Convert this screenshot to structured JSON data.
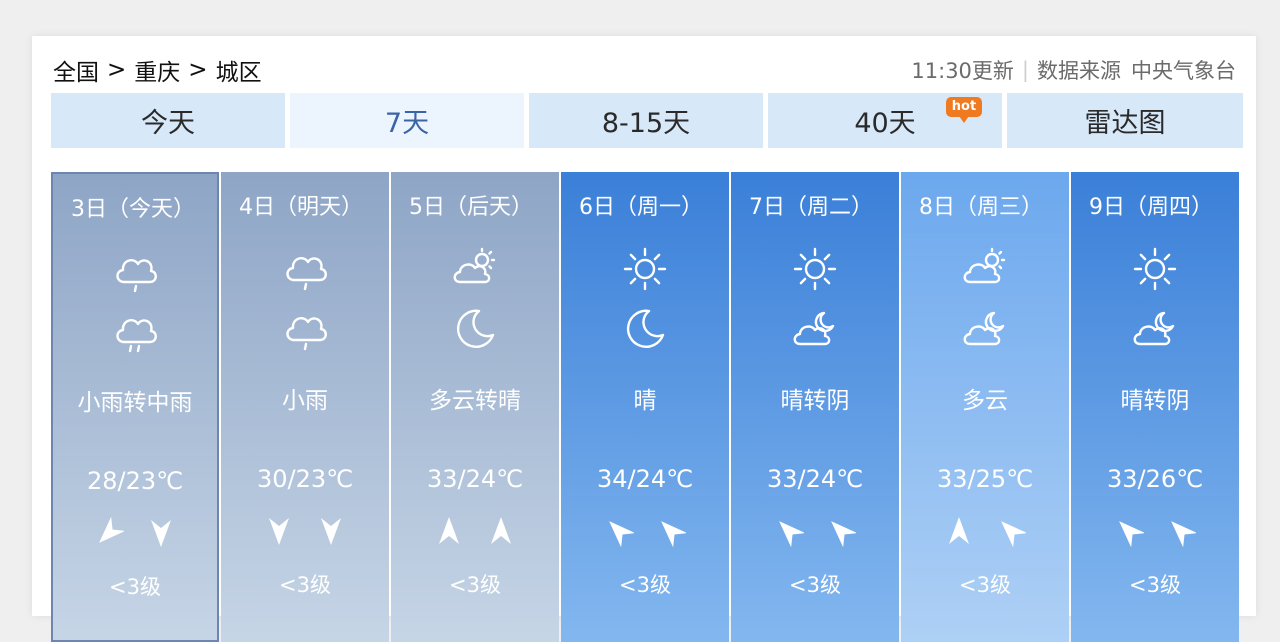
{
  "breadcrumb": {
    "country": "全国",
    "sep": ">",
    "province": "重庆",
    "district": "城区"
  },
  "meta": {
    "update": "11:30更新",
    "divider": "|",
    "source_label": "数据来源",
    "source": "中央气象台"
  },
  "tabs": [
    {
      "label": "今天",
      "active": false
    },
    {
      "label": "7天",
      "active": true
    },
    {
      "label": "8-15天",
      "active": false
    },
    {
      "label": "40天",
      "active": false,
      "badge": "hot"
    },
    {
      "label": "雷达图",
      "active": false
    }
  ],
  "days": [
    {
      "date": "3日（今天）",
      "day_icon": "rain-light-icon",
      "night_icon": "rain-medium-icon",
      "desc": "小雨转中雨",
      "temp": "28/23℃",
      "wind": [
        "northeast-wind-icon",
        "north-wind-icon"
      ],
      "wind_level": "<3级",
      "style": "past-selected"
    },
    {
      "date": "4日（明天）",
      "day_icon": "rain-light-icon",
      "night_icon": "rain-light-icon",
      "desc": "小雨",
      "temp": "30/23℃",
      "wind": [
        "north-wind-icon",
        "north-wind-icon"
      ],
      "wind_level": "<3级",
      "style": "past"
    },
    {
      "date": "5日（后天）",
      "day_icon": "partly-cloudy-icon",
      "night_icon": "moon-icon",
      "desc": "多云转晴",
      "temp": "33/24℃",
      "wind": [
        "south-wind-icon",
        "south-wind-icon"
      ],
      "wind_level": "<3级",
      "style": "past"
    },
    {
      "date": "6日（周一）",
      "day_icon": "sun-icon",
      "night_icon": "moon-icon",
      "desc": "晴",
      "temp": "34/24℃",
      "wind": [
        "southeast-wind-icon",
        "southeast-wind-icon"
      ],
      "wind_level": "<3级",
      "style": "blue"
    },
    {
      "date": "7日（周二）",
      "day_icon": "sun-icon",
      "night_icon": "cloudy-night-icon",
      "desc": "晴转阴",
      "temp": "33/24℃",
      "wind": [
        "southeast-wind-icon",
        "southeast-wind-icon"
      ],
      "wind_level": "<3级",
      "style": "blue"
    },
    {
      "date": "8日（周三）",
      "day_icon": "partly-cloudy-icon",
      "night_icon": "cloudy-night-icon",
      "desc": "多云",
      "temp": "33/25℃",
      "wind": [
        "south-wind-icon",
        "southeast-wind-icon"
      ],
      "wind_level": "<3级",
      "style": "light"
    },
    {
      "date": "9日（周四）",
      "day_icon": "sun-icon",
      "night_icon": "cloudy-night-icon",
      "desc": "晴转阴",
      "temp": "33/26℃",
      "wind": [
        "southeast-wind-icon",
        "southeast-wind-icon"
      ],
      "wind_level": "<3级",
      "style": "blue"
    }
  ],
  "colors": {
    "past": "#8ea5c6",
    "blue": "#3a7fd8",
    "light": "#6ca8ee",
    "tab": "#d7e8f8",
    "tab_active_text": "#3b63a8",
    "hot_badge": "#f07a1f"
  }
}
